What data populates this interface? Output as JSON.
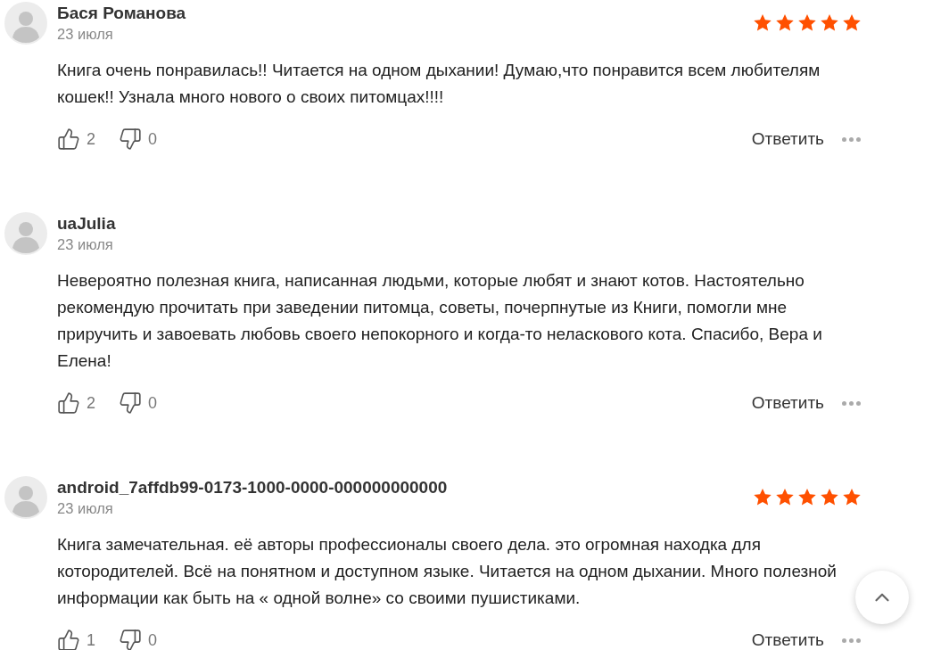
{
  "reviews": [
    {
      "author": "Бася Романова",
      "date": "23 июля",
      "stars": 5,
      "text": "Книга очень понравилась!! Читается на одном дыхании! Думаю,что понравится всем любителям кошек!! Узнала много нового о своих питомцах!!!!",
      "likes": "2",
      "dislikes": "0",
      "reply": "Ответить"
    },
    {
      "author": "uaJulia",
      "date": "23 июля",
      "text": "Невероятно полезная книга, написанная людьми, которые любят и знают котов. Настоятельно рекомендую прочитать при заведении питомца, советы, почерпнутые из Книги, помогли мне приручить и завоевать любовь своего непокорного и когда-то неласкового кота. Спасибо, Вера и Елена!",
      "likes": "2",
      "dislikes": "0",
      "reply": "Ответить"
    },
    {
      "author": "android_7affdb99-0173-1000-0000-000000000000",
      "date": "23 июля",
      "stars": 5,
      "text": "Книга замечательная. её авторы профессионалы своего дела. это огромная находка для котородителей. Всё на понятном и доступном языке. Читается на одном дыхании. Много полезной информации как быть на « одной волне» со своими пушистиками.",
      "likes": "1",
      "dislikes": "0",
      "reply": "Ответить"
    }
  ]
}
